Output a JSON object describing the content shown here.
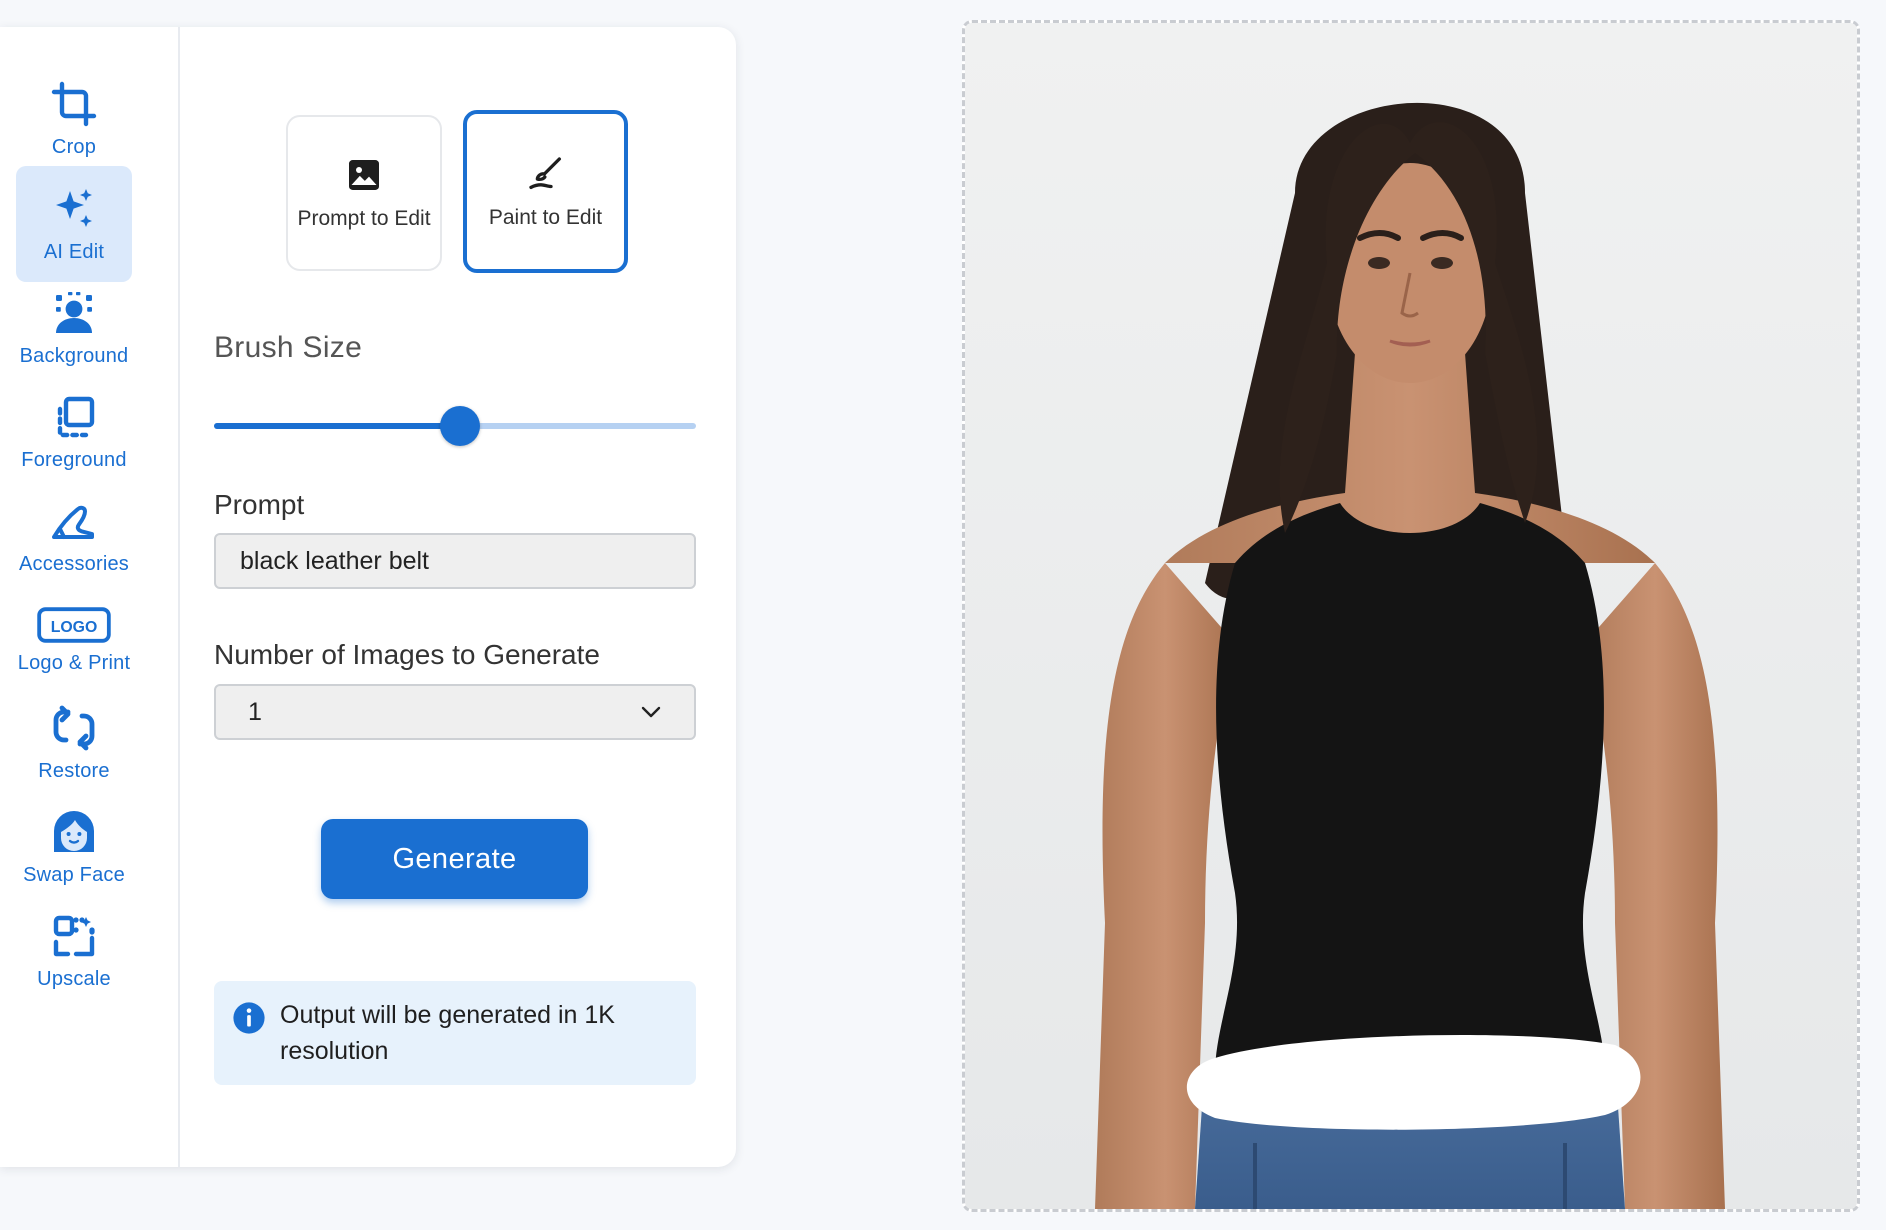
{
  "sidebar": {
    "items": [
      {
        "label": "Crop",
        "icon": "crop-icon"
      },
      {
        "label": "AI Edit",
        "icon": "sparkles-icon",
        "active": true
      },
      {
        "label": "Background",
        "icon": "background-person-icon"
      },
      {
        "label": "Foreground",
        "icon": "foreground-layers-icon"
      },
      {
        "label": "Accessories",
        "icon": "high-heel-icon"
      },
      {
        "label": "Logo & Print",
        "icon": "logo-badge-icon",
        "badge_text": "LOGO"
      },
      {
        "label": "Restore",
        "icon": "restore-arrows-icon"
      },
      {
        "label": "Swap Face",
        "icon": "face-icon"
      },
      {
        "label": "Upscale",
        "icon": "upscale-icon"
      }
    ]
  },
  "modes": {
    "prompt_label": "Prompt to Edit",
    "paint_label": "Paint to Edit",
    "selected": "Paint to Edit"
  },
  "brush": {
    "label": "Brush Size",
    "value_fraction": 0.51
  },
  "prompt": {
    "label": "Prompt",
    "value": "black leather belt"
  },
  "count": {
    "label": "Number of Images to Generate",
    "selected": "1"
  },
  "generate_label": "Generate",
  "info_text": "Output will be generated in 1K resolution",
  "colors": {
    "accent": "#1a6fd1",
    "accent_light": "#dbe9fb",
    "info_bg": "#e7f2fc",
    "page_bg": "#f6f8fb"
  }
}
